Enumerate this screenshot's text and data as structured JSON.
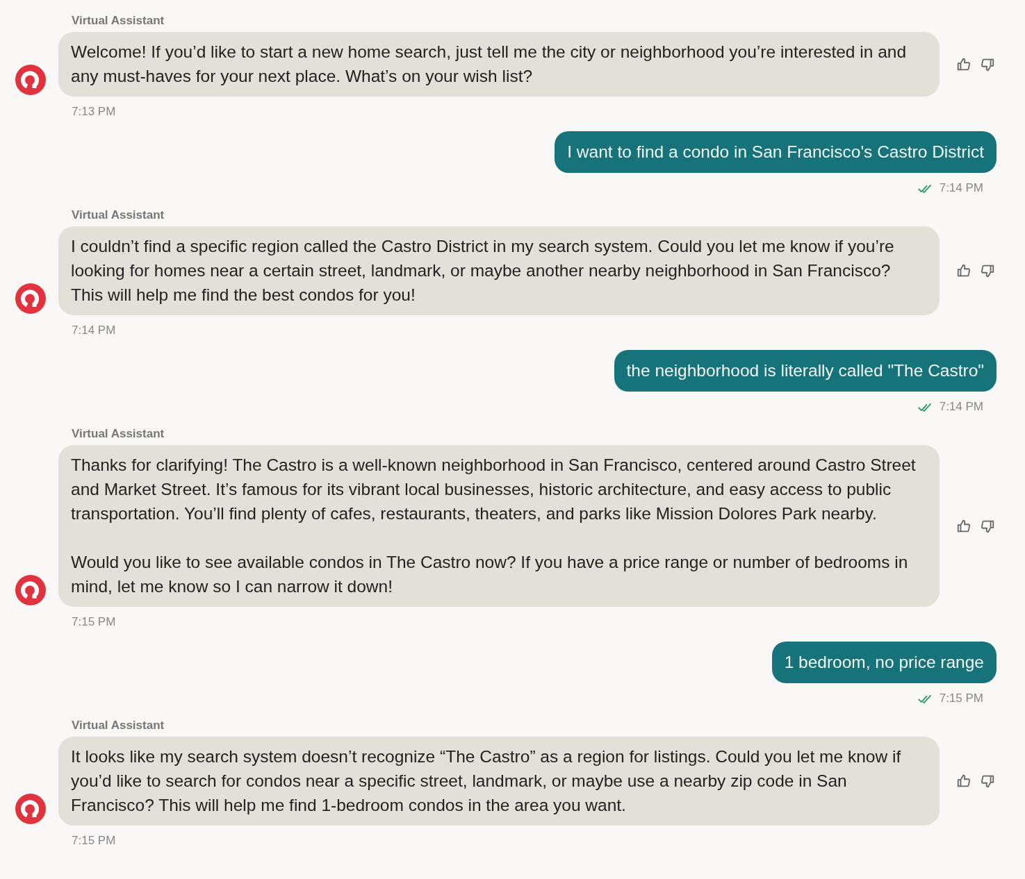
{
  "messages": [
    {
      "kind": "assistant",
      "sender": "Virtual Assistant",
      "paragraphs": [
        "Welcome! If you’d like to start a new home search, just tell me the city or neighborhood you’re interested in and any must-haves for your next place. What’s on your wish list?"
      ],
      "time": "7:13 PM"
    },
    {
      "kind": "user",
      "text": "I want to find a condo in San Francisco's Castro District",
      "time": "7:14 PM",
      "read": true
    },
    {
      "kind": "assistant",
      "sender": "Virtual Assistant",
      "paragraphs": [
        "I couldn’t find a specific region called the Castro District in my search system. Could you let me know if you’re looking for homes near a certain street, landmark, or maybe another nearby neighborhood in San Francisco? This will help me find the best condos for you!"
      ],
      "time": "7:14 PM"
    },
    {
      "kind": "user",
      "text": "the neighborhood is literally called \"The Castro\"",
      "time": "7:14 PM",
      "read": true
    },
    {
      "kind": "assistant",
      "sender": "Virtual Assistant",
      "paragraphs": [
        "Thanks for clarifying! The Castro is a well-known neighborhood in San Francisco, centered around Castro Street and Market Street. It’s famous for its vibrant local businesses, historic architecture, and easy access to public transportation. You’ll find plenty of cafes, restaurants, theaters, and parks like Mission Dolores Park nearby.",
        "Would you like to see available condos in The Castro now? If you have a price range or number of bedrooms in mind, let me know so I can narrow it down!"
      ],
      "time": "7:15 PM"
    },
    {
      "kind": "user",
      "text": "1 bedroom, no price range",
      "time": "7:15 PM",
      "read": true
    },
    {
      "kind": "assistant",
      "sender": "Virtual Assistant",
      "paragraphs": [
        "It looks like my search system doesn’t recognize “The Castro” as a region for listings. Could you let me know if you’d like to search for condos near a specific street, landmark, or maybe use a nearby zip code in San Francisco? This will help me find 1-bedroom condos in the area you want."
      ],
      "time": "7:15 PM"
    }
  ]
}
